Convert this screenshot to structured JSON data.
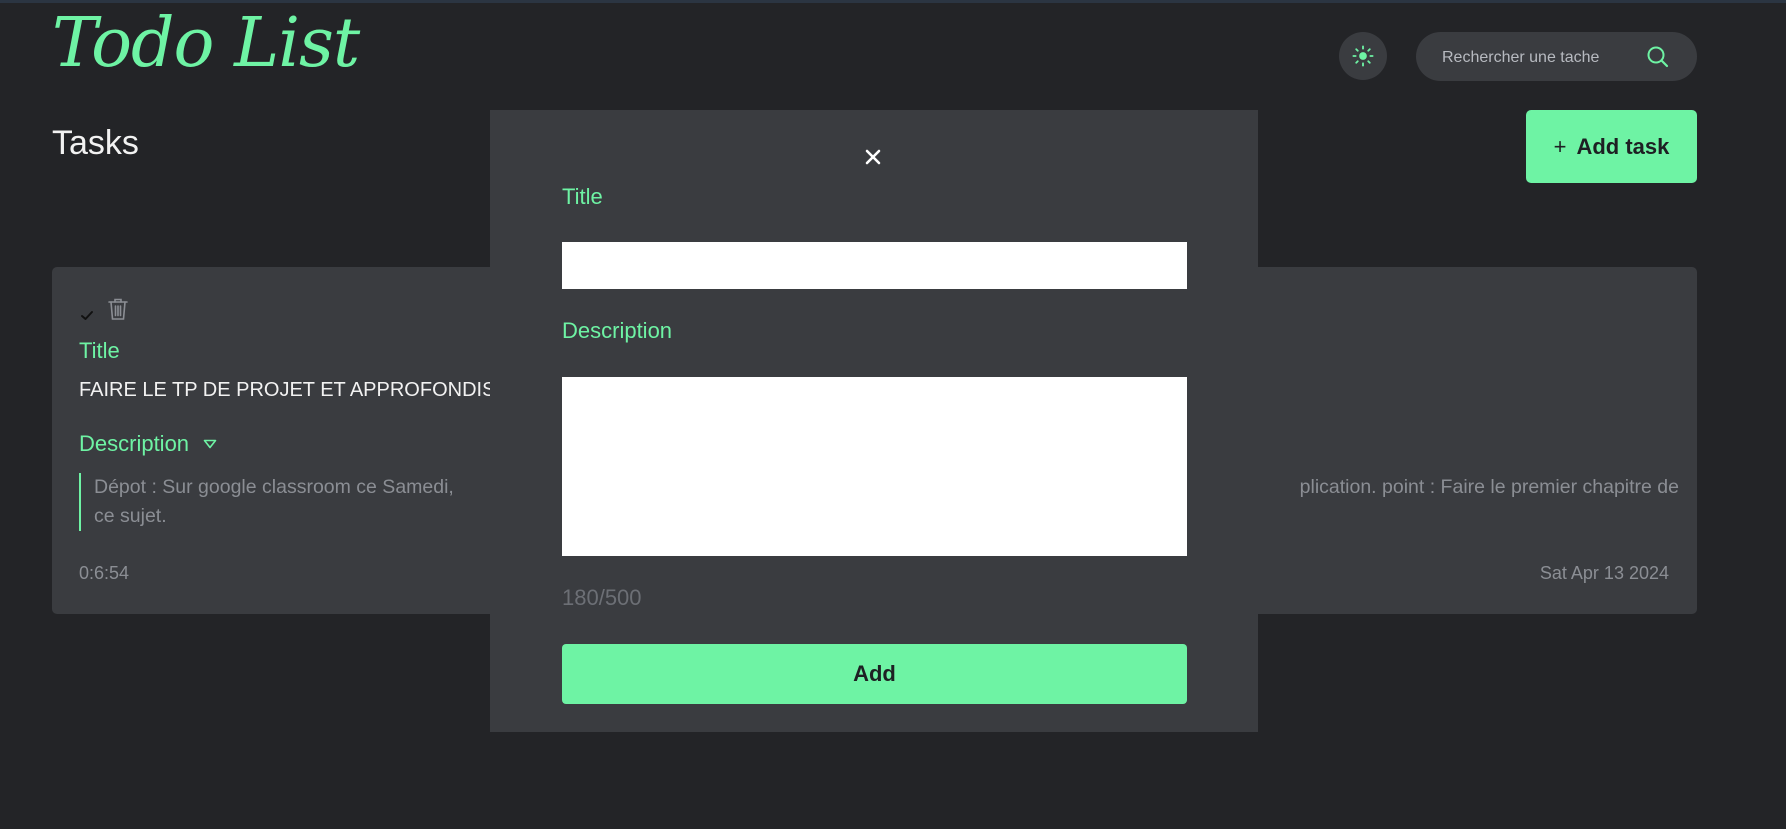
{
  "app": {
    "logo": "Todo List"
  },
  "header": {
    "theme_toggle_icon": "sun-icon",
    "search": {
      "placeholder": "Rechercher une tache",
      "icon": "search-icon"
    }
  },
  "main": {
    "title": "Tasks",
    "add_task_label": "Add task",
    "add_task_icon": "plus-icon"
  },
  "task": {
    "title_label": "Title",
    "title_text": "FAIRE LE TP DE PROJET ET APPROFONDIS",
    "description_label": "Description",
    "description_text": "Dépot : Sur google classroom ce Samedi,",
    "description_text_right": "plication. point : Faire le premier chapitre de",
    "description_text_line2": "ce sujet.",
    "elapsed": "0:6:54",
    "date": "Sat Apr 13 2024"
  },
  "modal": {
    "title_label": "Title",
    "title_value": "",
    "description_label": "Description",
    "description_value": "",
    "counter": "180/500",
    "submit_label": "Add"
  },
  "colors": {
    "accent": "#6ef3a4",
    "background": "#232427",
    "surface": "#3a3c40",
    "muted_text": "#8b8e94"
  }
}
